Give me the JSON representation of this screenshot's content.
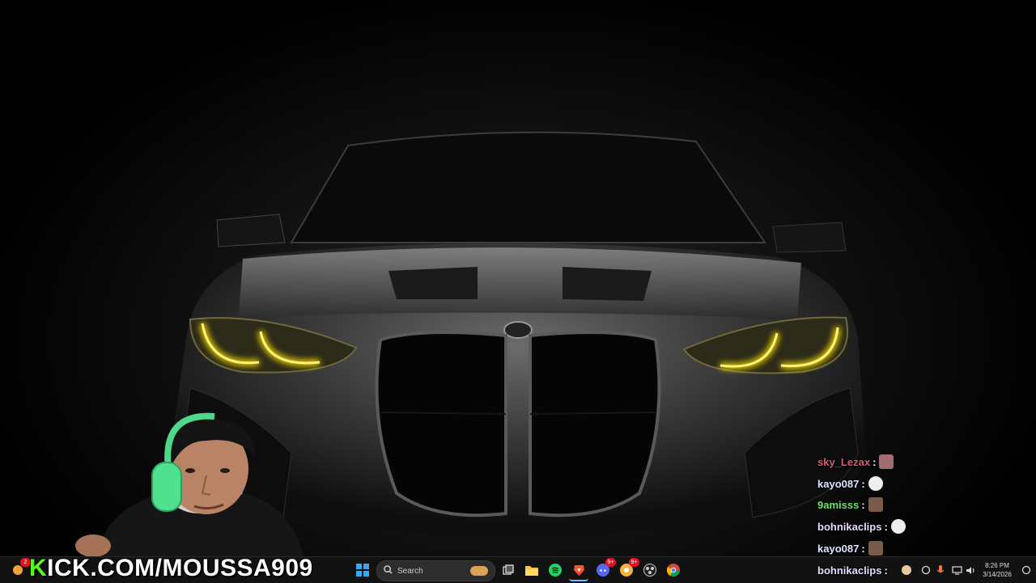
{
  "stream": {
    "watermark_prefix": "K",
    "watermark_rest": "ICK.COM/MOUSSA909"
  },
  "chat": [
    {
      "user": "sky_Lezax",
      "color": "#d65b7a",
      "sep": ":"
    },
    {
      "user": "kayo087",
      "color": "#dfe6ff",
      "sep": ":"
    },
    {
      "user": "9amisss",
      "color": "#6fe36a",
      "sep": ":"
    },
    {
      "user": "bohnikaclips",
      "color": "#e8d9ff",
      "sep": ":"
    },
    {
      "user": "kayo087",
      "color": "#dfe6ff",
      "sep": ":"
    },
    {
      "user": "bohnikaclips",
      "color": "#e8d9ff",
      "sep": ":"
    }
  ],
  "taskbar": {
    "search_placeholder": "Search",
    "weather_badge": "2",
    "discord_badge": "9+",
    "app_badge": "9+",
    "clock_time": "8:26 PM",
    "clock_date": "3/14/2026",
    "icons": [
      "windows-start-icon",
      "search-icon",
      "task-view-icon",
      "file-explorer-icon",
      "spotify-icon",
      "brave-icon",
      "discord-icon",
      "notification-app-icon",
      "obs-icon",
      "chrome-icon"
    ]
  }
}
